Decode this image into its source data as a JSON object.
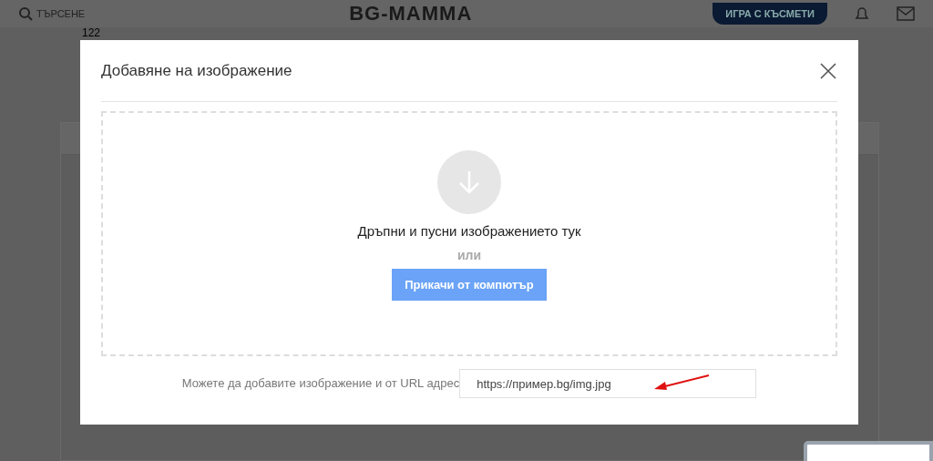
{
  "header": {
    "search_label": "ТЪРСЕНЕ",
    "logo": "BG-MAMMA",
    "promo_button": "ИГРА С КЪСМЕТИ"
  },
  "page": {
    "counter": "122"
  },
  "modal": {
    "title": "Добавяне на изображение",
    "dropzone": {
      "prompt": "Дръпни и пусни изображението тук",
      "separator": "или",
      "upload_button": "Прикачи от компютър"
    },
    "url_label": "Можете да добавите изображение и от URL адрес",
    "url_field": {
      "placeholder": "https://пример.bg/img.jpg"
    }
  }
}
